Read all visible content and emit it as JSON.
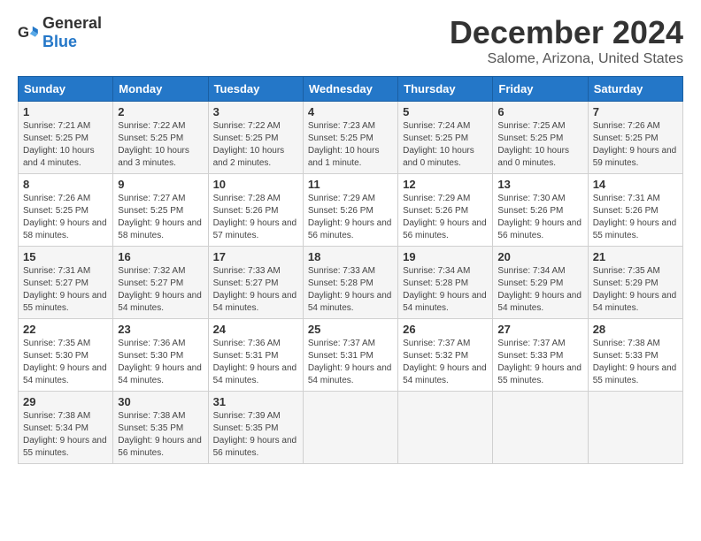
{
  "logo": {
    "general": "General",
    "blue": "Blue"
  },
  "title": "December 2024",
  "subtitle": "Salome, Arizona, United States",
  "days_of_week": [
    "Sunday",
    "Monday",
    "Tuesday",
    "Wednesday",
    "Thursday",
    "Friday",
    "Saturday"
  ],
  "weeks": [
    [
      {
        "day": "1",
        "sunrise": "7:21 AM",
        "sunset": "5:25 PM",
        "daylight": "10 hours and 4 minutes."
      },
      {
        "day": "2",
        "sunrise": "7:22 AM",
        "sunset": "5:25 PM",
        "daylight": "10 hours and 3 minutes."
      },
      {
        "day": "3",
        "sunrise": "7:22 AM",
        "sunset": "5:25 PM",
        "daylight": "10 hours and 2 minutes."
      },
      {
        "day": "4",
        "sunrise": "7:23 AM",
        "sunset": "5:25 PM",
        "daylight": "10 hours and 1 minute."
      },
      {
        "day": "5",
        "sunrise": "7:24 AM",
        "sunset": "5:25 PM",
        "daylight": "10 hours and 0 minutes."
      },
      {
        "day": "6",
        "sunrise": "7:25 AM",
        "sunset": "5:25 PM",
        "daylight": "10 hours and 0 minutes."
      },
      {
        "day": "7",
        "sunrise": "7:26 AM",
        "sunset": "5:25 PM",
        "daylight": "9 hours and 59 minutes."
      }
    ],
    [
      {
        "day": "8",
        "sunrise": "7:26 AM",
        "sunset": "5:25 PM",
        "daylight": "9 hours and 58 minutes."
      },
      {
        "day": "9",
        "sunrise": "7:27 AM",
        "sunset": "5:25 PM",
        "daylight": "9 hours and 58 minutes."
      },
      {
        "day": "10",
        "sunrise": "7:28 AM",
        "sunset": "5:26 PM",
        "daylight": "9 hours and 57 minutes."
      },
      {
        "day": "11",
        "sunrise": "7:29 AM",
        "sunset": "5:26 PM",
        "daylight": "9 hours and 56 minutes."
      },
      {
        "day": "12",
        "sunrise": "7:29 AM",
        "sunset": "5:26 PM",
        "daylight": "9 hours and 56 minutes."
      },
      {
        "day": "13",
        "sunrise": "7:30 AM",
        "sunset": "5:26 PM",
        "daylight": "9 hours and 56 minutes."
      },
      {
        "day": "14",
        "sunrise": "7:31 AM",
        "sunset": "5:26 PM",
        "daylight": "9 hours and 55 minutes."
      }
    ],
    [
      {
        "day": "15",
        "sunrise": "7:31 AM",
        "sunset": "5:27 PM",
        "daylight": "9 hours and 55 minutes."
      },
      {
        "day": "16",
        "sunrise": "7:32 AM",
        "sunset": "5:27 PM",
        "daylight": "9 hours and 54 minutes."
      },
      {
        "day": "17",
        "sunrise": "7:33 AM",
        "sunset": "5:27 PM",
        "daylight": "9 hours and 54 minutes."
      },
      {
        "day": "18",
        "sunrise": "7:33 AM",
        "sunset": "5:28 PM",
        "daylight": "9 hours and 54 minutes."
      },
      {
        "day": "19",
        "sunrise": "7:34 AM",
        "sunset": "5:28 PM",
        "daylight": "9 hours and 54 minutes."
      },
      {
        "day": "20",
        "sunrise": "7:34 AM",
        "sunset": "5:29 PM",
        "daylight": "9 hours and 54 minutes."
      },
      {
        "day": "21",
        "sunrise": "7:35 AM",
        "sunset": "5:29 PM",
        "daylight": "9 hours and 54 minutes."
      }
    ],
    [
      {
        "day": "22",
        "sunrise": "7:35 AM",
        "sunset": "5:30 PM",
        "daylight": "9 hours and 54 minutes."
      },
      {
        "day": "23",
        "sunrise": "7:36 AM",
        "sunset": "5:30 PM",
        "daylight": "9 hours and 54 minutes."
      },
      {
        "day": "24",
        "sunrise": "7:36 AM",
        "sunset": "5:31 PM",
        "daylight": "9 hours and 54 minutes."
      },
      {
        "day": "25",
        "sunrise": "7:37 AM",
        "sunset": "5:31 PM",
        "daylight": "9 hours and 54 minutes."
      },
      {
        "day": "26",
        "sunrise": "7:37 AM",
        "sunset": "5:32 PM",
        "daylight": "9 hours and 54 minutes."
      },
      {
        "day": "27",
        "sunrise": "7:37 AM",
        "sunset": "5:33 PM",
        "daylight": "9 hours and 55 minutes."
      },
      {
        "day": "28",
        "sunrise": "7:38 AM",
        "sunset": "5:33 PM",
        "daylight": "9 hours and 55 minutes."
      }
    ],
    [
      {
        "day": "29",
        "sunrise": "7:38 AM",
        "sunset": "5:34 PM",
        "daylight": "9 hours and 55 minutes."
      },
      {
        "day": "30",
        "sunrise": "7:38 AM",
        "sunset": "5:35 PM",
        "daylight": "9 hours and 56 minutes."
      },
      {
        "day": "31",
        "sunrise": "7:39 AM",
        "sunset": "5:35 PM",
        "daylight": "9 hours and 56 minutes."
      },
      null,
      null,
      null,
      null
    ]
  ]
}
